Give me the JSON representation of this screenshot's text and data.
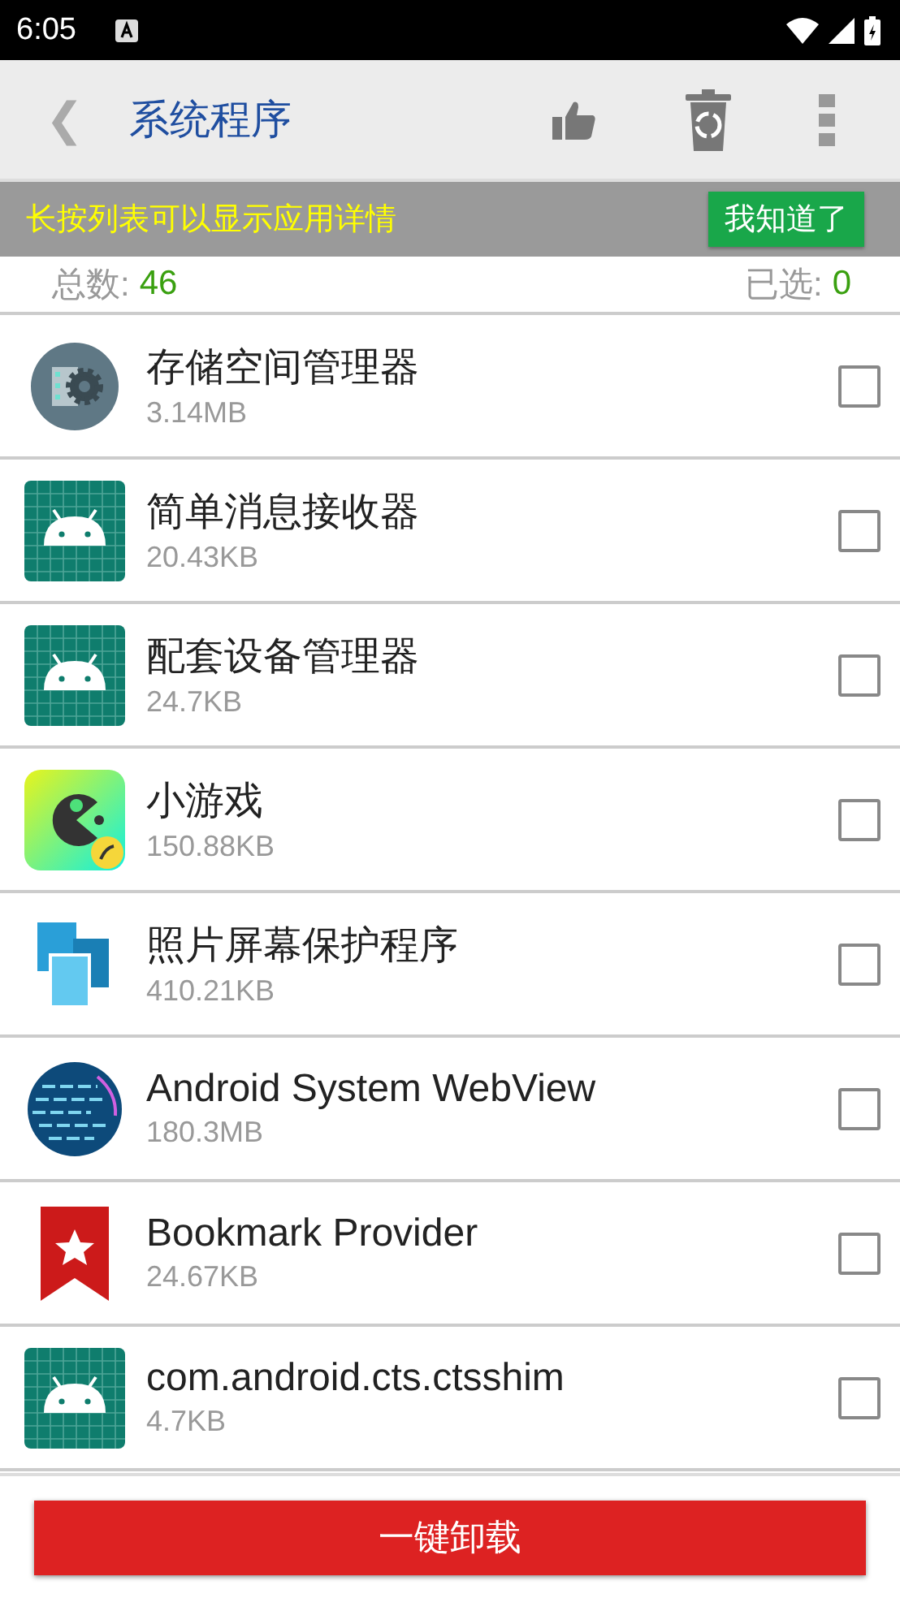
{
  "status_bar": {
    "time": "6:05"
  },
  "toolbar": {
    "back": "❮",
    "title": "系统程序"
  },
  "banner": {
    "text": "长按列表可以显示应用详情",
    "button": "我知道了"
  },
  "summary": {
    "total_label": "总数:",
    "total": "46",
    "selected_label": "已选:",
    "selected": "0"
  },
  "apps": [
    {
      "name": "存储空间管理器",
      "size": "3.14MB",
      "checked": false
    },
    {
      "name": "简单消息接收器",
      "size": "20.43KB",
      "checked": false
    },
    {
      "name": "配套设备管理器",
      "size": "24.7KB",
      "checked": false
    },
    {
      "name": "小游戏",
      "size": "150.88KB",
      "checked": false
    },
    {
      "name": "照片屏幕保护程序",
      "size": "410.21KB",
      "checked": false
    },
    {
      "name": "Android System WebView",
      "size": "180.3MB",
      "checked": false
    },
    {
      "name": "Bookmark Provider",
      "size": "24.67KB",
      "checked": false
    },
    {
      "name": "com.android.cts.ctsshim",
      "size": "4.7KB",
      "checked": false
    }
  ],
  "uninstall_button": "一键卸载"
}
